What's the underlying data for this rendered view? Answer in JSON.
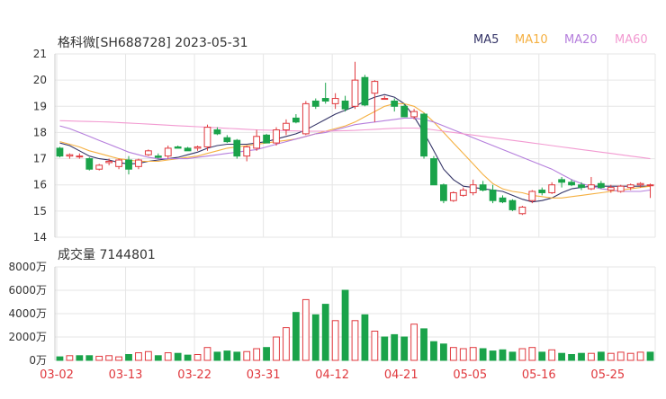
{
  "header": {
    "title": "格科微[SH688728] 2023-05-31"
  },
  "legend": [
    {
      "label": "MA5",
      "color": "#333366"
    },
    {
      "label": "MA10",
      "color": "#f5b041"
    },
    {
      "label": "MA20",
      "color": "#b57edc"
    },
    {
      "label": "MA60",
      "color": "#f29ad1"
    }
  ],
  "volume": {
    "label": "成交量",
    "last_value": "7144801",
    "yticks": [
      "8000万",
      "6000万",
      "4000万",
      "2000万",
      "0万"
    ]
  },
  "colors": {
    "up": "#e0393e",
    "down": "#1aa34a",
    "grid": "#e6e6e6",
    "axis_text": "#333333",
    "date_text": "#e0393e"
  },
  "chart_data": [
    {
      "type": "candlestick",
      "ylim": [
        14,
        21
      ],
      "yticks": [
        14,
        15,
        16,
        17,
        18,
        19,
        20,
        21
      ],
      "xtick_labels": [
        "03-02",
        "03-13",
        "03-22",
        "03-31",
        "04-12",
        "04-21",
        "05-05",
        "05-16",
        "05-25"
      ],
      "xtick_index": [
        0,
        7,
        14,
        21,
        28,
        35,
        42,
        49,
        56
      ],
      "ohlc": [
        [
          17.4,
          17.45,
          17.05,
          17.1
        ],
        [
          17.1,
          17.2,
          17.0,
          17.15
        ],
        [
          17.1,
          17.2,
          17.0,
          17.1
        ],
        [
          17.0,
          17.05,
          16.55,
          16.6
        ],
        [
          16.6,
          16.8,
          16.55,
          16.75
        ],
        [
          16.85,
          17.0,
          16.75,
          16.9
        ],
        [
          16.7,
          17.0,
          16.6,
          16.95
        ],
        [
          16.95,
          17.1,
          16.4,
          16.6
        ],
        [
          16.7,
          17.0,
          16.6,
          16.95
        ],
        [
          17.15,
          17.35,
          17.1,
          17.3
        ],
        [
          17.1,
          17.2,
          17.0,
          17.05
        ],
        [
          17.1,
          17.5,
          17.0,
          17.4
        ],
        [
          17.45,
          17.5,
          17.4,
          17.4
        ],
        [
          17.4,
          17.45,
          17.3,
          17.3
        ],
        [
          17.4,
          17.5,
          17.3,
          17.45
        ],
        [
          17.45,
          18.3,
          17.3,
          18.2
        ],
        [
          18.1,
          18.2,
          17.9,
          17.95
        ],
        [
          17.8,
          17.9,
          17.6,
          17.65
        ],
        [
          17.7,
          17.75,
          17.0,
          17.1
        ],
        [
          17.1,
          17.5,
          16.9,
          17.45
        ],
        [
          17.4,
          18.1,
          17.3,
          17.85
        ],
        [
          17.9,
          17.95,
          17.6,
          17.6
        ],
        [
          17.6,
          18.2,
          17.5,
          18.1
        ],
        [
          18.1,
          18.5,
          17.9,
          18.35
        ],
        [
          18.55,
          18.7,
          18.35,
          18.4
        ],
        [
          17.95,
          19.2,
          17.9,
          19.1
        ],
        [
          19.2,
          19.3,
          18.9,
          19.0
        ],
        [
          19.3,
          19.9,
          19.1,
          19.2
        ],
        [
          19.1,
          19.5,
          18.9,
          19.3
        ],
        [
          19.2,
          19.4,
          18.8,
          18.9
        ],
        [
          19.0,
          20.7,
          18.9,
          20.0
        ],
        [
          20.1,
          20.2,
          19.0,
          19.05
        ],
        [
          19.5,
          20.0,
          18.4,
          19.95
        ],
        [
          19.3,
          19.4,
          19.25,
          19.3
        ],
        [
          19.2,
          19.3,
          18.8,
          19.0
        ],
        [
          19.0,
          19.1,
          18.6,
          18.6
        ],
        [
          18.6,
          18.9,
          18.5,
          18.8
        ],
        [
          18.7,
          18.75,
          17.0,
          17.1
        ],
        [
          17.0,
          17.1,
          16.0,
          16.0
        ],
        [
          16.0,
          16.05,
          15.3,
          15.4
        ],
        [
          15.4,
          15.75,
          15.35,
          15.7
        ],
        [
          15.6,
          15.9,
          15.55,
          15.8
        ],
        [
          15.7,
          16.2,
          15.6,
          16.0
        ],
        [
          16.0,
          16.15,
          15.75,
          15.8
        ],
        [
          15.8,
          16.0,
          15.3,
          15.4
        ],
        [
          15.5,
          15.6,
          15.3,
          15.35
        ],
        [
          15.4,
          15.45,
          15.0,
          15.05
        ],
        [
          14.9,
          15.2,
          14.85,
          15.15
        ],
        [
          15.4,
          15.8,
          15.3,
          15.75
        ],
        [
          15.8,
          15.9,
          15.6,
          15.7
        ],
        [
          15.7,
          16.1,
          15.65,
          16.0
        ],
        [
          16.2,
          16.3,
          15.9,
          16.1
        ],
        [
          16.1,
          16.2,
          15.95,
          16.0
        ],
        [
          16.0,
          16.1,
          15.8,
          15.9
        ],
        [
          15.85,
          16.3,
          15.8,
          16.0
        ],
        [
          16.05,
          16.15,
          15.85,
          15.9
        ],
        [
          15.8,
          16.0,
          15.7,
          15.9
        ],
        [
          15.75,
          16.0,
          15.7,
          15.95
        ],
        [
          15.9,
          16.05,
          15.8,
          16.0
        ],
        [
          16.0,
          16.1,
          15.9,
          16.05
        ],
        [
          16.0,
          16.05,
          15.5,
          16.0
        ]
      ],
      "series": [
        {
          "name": "MA5",
          "values": [
            17.6,
            17.5,
            17.3,
            17.1,
            17.0,
            16.95,
            16.85,
            16.8,
            16.82,
            16.9,
            16.95,
            17.0,
            17.05,
            17.15,
            17.25,
            17.4,
            17.5,
            17.55,
            17.55,
            17.55,
            17.6,
            17.65,
            17.75,
            17.85,
            17.95,
            18.1,
            18.3,
            18.5,
            18.7,
            18.85,
            19.0,
            19.2,
            19.35,
            19.45,
            19.35,
            19.1,
            18.6,
            18.0,
            17.3,
            16.6,
            16.2,
            15.95,
            15.9,
            15.85,
            15.8,
            15.75,
            15.6,
            15.45,
            15.35,
            15.4,
            15.5,
            15.7,
            15.85,
            15.9,
            15.95,
            15.95,
            15.95,
            15.95,
            15.95,
            15.95,
            15.95
          ]
        },
        {
          "name": "MA10",
          "values": [
            17.65,
            17.55,
            17.45,
            17.3,
            17.2,
            17.1,
            17.0,
            16.95,
            16.9,
            16.9,
            16.9,
            16.95,
            17.0,
            17.05,
            17.1,
            17.2,
            17.3,
            17.4,
            17.45,
            17.5,
            17.55,
            17.6,
            17.65,
            17.7,
            17.75,
            17.85,
            17.95,
            18.05,
            18.15,
            18.25,
            18.4,
            18.6,
            18.8,
            19.0,
            19.1,
            19.1,
            19.0,
            18.75,
            18.4,
            18.0,
            17.6,
            17.2,
            16.8,
            16.4,
            16.05,
            15.85,
            15.75,
            15.7,
            15.6,
            15.55,
            15.5,
            15.5,
            15.55,
            15.6,
            15.65,
            15.7,
            15.75,
            15.8,
            15.85,
            15.9,
            15.95
          ]
        },
        {
          "name": "MA20",
          "values": [
            18.25,
            18.15,
            18.0,
            17.85,
            17.7,
            17.55,
            17.4,
            17.25,
            17.15,
            17.05,
            17.0,
            17.0,
            17.0,
            17.0,
            17.05,
            17.1,
            17.15,
            17.2,
            17.25,
            17.3,
            17.35,
            17.45,
            17.55,
            17.65,
            17.75,
            17.85,
            17.95,
            18.0,
            18.1,
            18.2,
            18.3,
            18.35,
            18.4,
            18.45,
            18.5,
            18.55,
            18.55,
            18.5,
            18.4,
            18.25,
            18.1,
            17.95,
            17.8,
            17.65,
            17.5,
            17.35,
            17.2,
            17.05,
            16.9,
            16.75,
            16.6,
            16.4,
            16.2,
            16.05,
            15.95,
            15.85,
            15.8,
            15.75,
            15.75,
            15.75,
            15.8
          ]
        },
        {
          "name": "MA60",
          "values": [
            18.45,
            18.44,
            18.43,
            18.42,
            18.41,
            18.4,
            18.38,
            18.36,
            18.34,
            18.32,
            18.3,
            18.28,
            18.26,
            18.24,
            18.22,
            18.2,
            18.18,
            18.16,
            18.14,
            18.12,
            18.1,
            18.09,
            18.08,
            18.07,
            18.06,
            18.05,
            18.05,
            18.05,
            18.06,
            18.07,
            18.08,
            18.1,
            18.12,
            18.14,
            18.16,
            18.17,
            18.17,
            18.15,
            18.1,
            18.05,
            18.0,
            17.95,
            17.9,
            17.85,
            17.8,
            17.75,
            17.7,
            17.65,
            17.6,
            17.55,
            17.5,
            17.45,
            17.4,
            17.35,
            17.3,
            17.25,
            17.2,
            17.15,
            17.1,
            17.05,
            17.0
          ]
        }
      ]
    },
    {
      "type": "bar",
      "ylim": [
        0,
        8000
      ],
      "yticks": [
        0,
        2000,
        4000,
        6000,
        8000
      ],
      "values": [
        300,
        400,
        400,
        400,
        350,
        400,
        300,
        500,
        650,
        750,
        400,
        650,
        600,
        450,
        500,
        1100,
        700,
        800,
        700,
        750,
        1000,
        1100,
        2000,
        2800,
        4100,
        5200,
        3900,
        4800,
        3400,
        6000,
        3400,
        3900,
        2500,
        2000,
        2200,
        2000,
        3100,
        2700,
        1600,
        1400,
        1100,
        1000,
        1100,
        1000,
        800,
        900,
        700,
        1000,
        1100,
        700,
        900,
        600,
        500,
        600,
        600,
        700,
        600,
        700,
        600,
        700,
        700
      ],
      "up": [
        false,
        true,
        false,
        false,
        true,
        true,
        true,
        false,
        true,
        true,
        false,
        true,
        false,
        false,
        true,
        true,
        false,
        false,
        false,
        true,
        true,
        false,
        true,
        true,
        false,
        true,
        false,
        false,
        true,
        false,
        true,
        false,
        true,
        false,
        false,
        false,
        true,
        false,
        false,
        false,
        true,
        true,
        true,
        false,
        false,
        false,
        false,
        true,
        true,
        false,
        true,
        false,
        false,
        false,
        true,
        false,
        true,
        true,
        true,
        true,
        false
      ]
    }
  ]
}
